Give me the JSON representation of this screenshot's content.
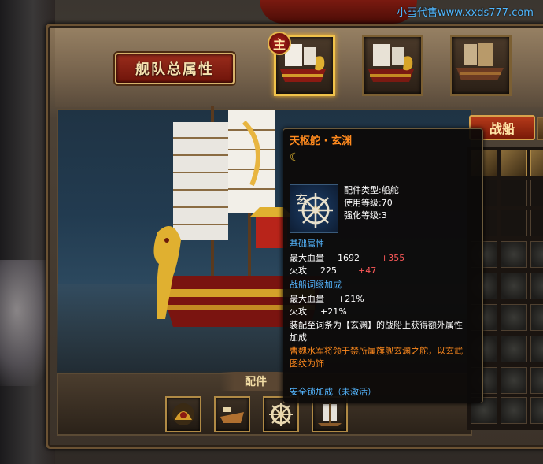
{
  "watermark": "小雪代售www.xxds777.com",
  "header": {
    "title": "舰队总属性",
    "main_badge": "主"
  },
  "ships": [
    {
      "name": "ship-slot-main",
      "active": true
    },
    {
      "name": "ship-slot-2",
      "active": false
    },
    {
      "name": "ship-slot-3",
      "active": false
    }
  ],
  "parts": {
    "label": "配件",
    "slots": [
      "part-slot-1",
      "part-slot-2",
      "part-slot-3",
      "part-slot-4"
    ]
  },
  "inventory": {
    "tab_label": "战船"
  },
  "tooltip": {
    "title": "天枢舵 · 玄渊",
    "moon_glyph": "☾",
    "icon_char": "玄",
    "part_type": "配件类型:船舵",
    "use_level": "使用等级:70",
    "enhance_level": "强化等级:3",
    "base_section": "基础属性",
    "base_stats": [
      {
        "label": "最大血量",
        "value": "1692",
        "bonus": "+355"
      },
      {
        "label": "火攻",
        "value": "225",
        "bonus": "+47"
      }
    ],
    "affix_section": "战船词缀加成",
    "affix_stats": [
      {
        "label": "最大血量",
        "value": "+21%"
      },
      {
        "label": "火攻",
        "value": "+21%"
      }
    ],
    "set_line1": "装配至词条为【玄渊】的战船上获得额外属性",
    "set_line2": "加成",
    "desc_line1": "曹魏水军将领于禁所属旗舰玄渊之舵，以玄武",
    "desc_line2": "图纹为饰",
    "lock": "安全锁加成（未激活）"
  },
  "colors": {
    "title_orange": "#ff8a1e",
    "section_blue": "#54b6ff",
    "bonus_red": "#ff5a5a",
    "frame_gold": "#d7b26a"
  }
}
